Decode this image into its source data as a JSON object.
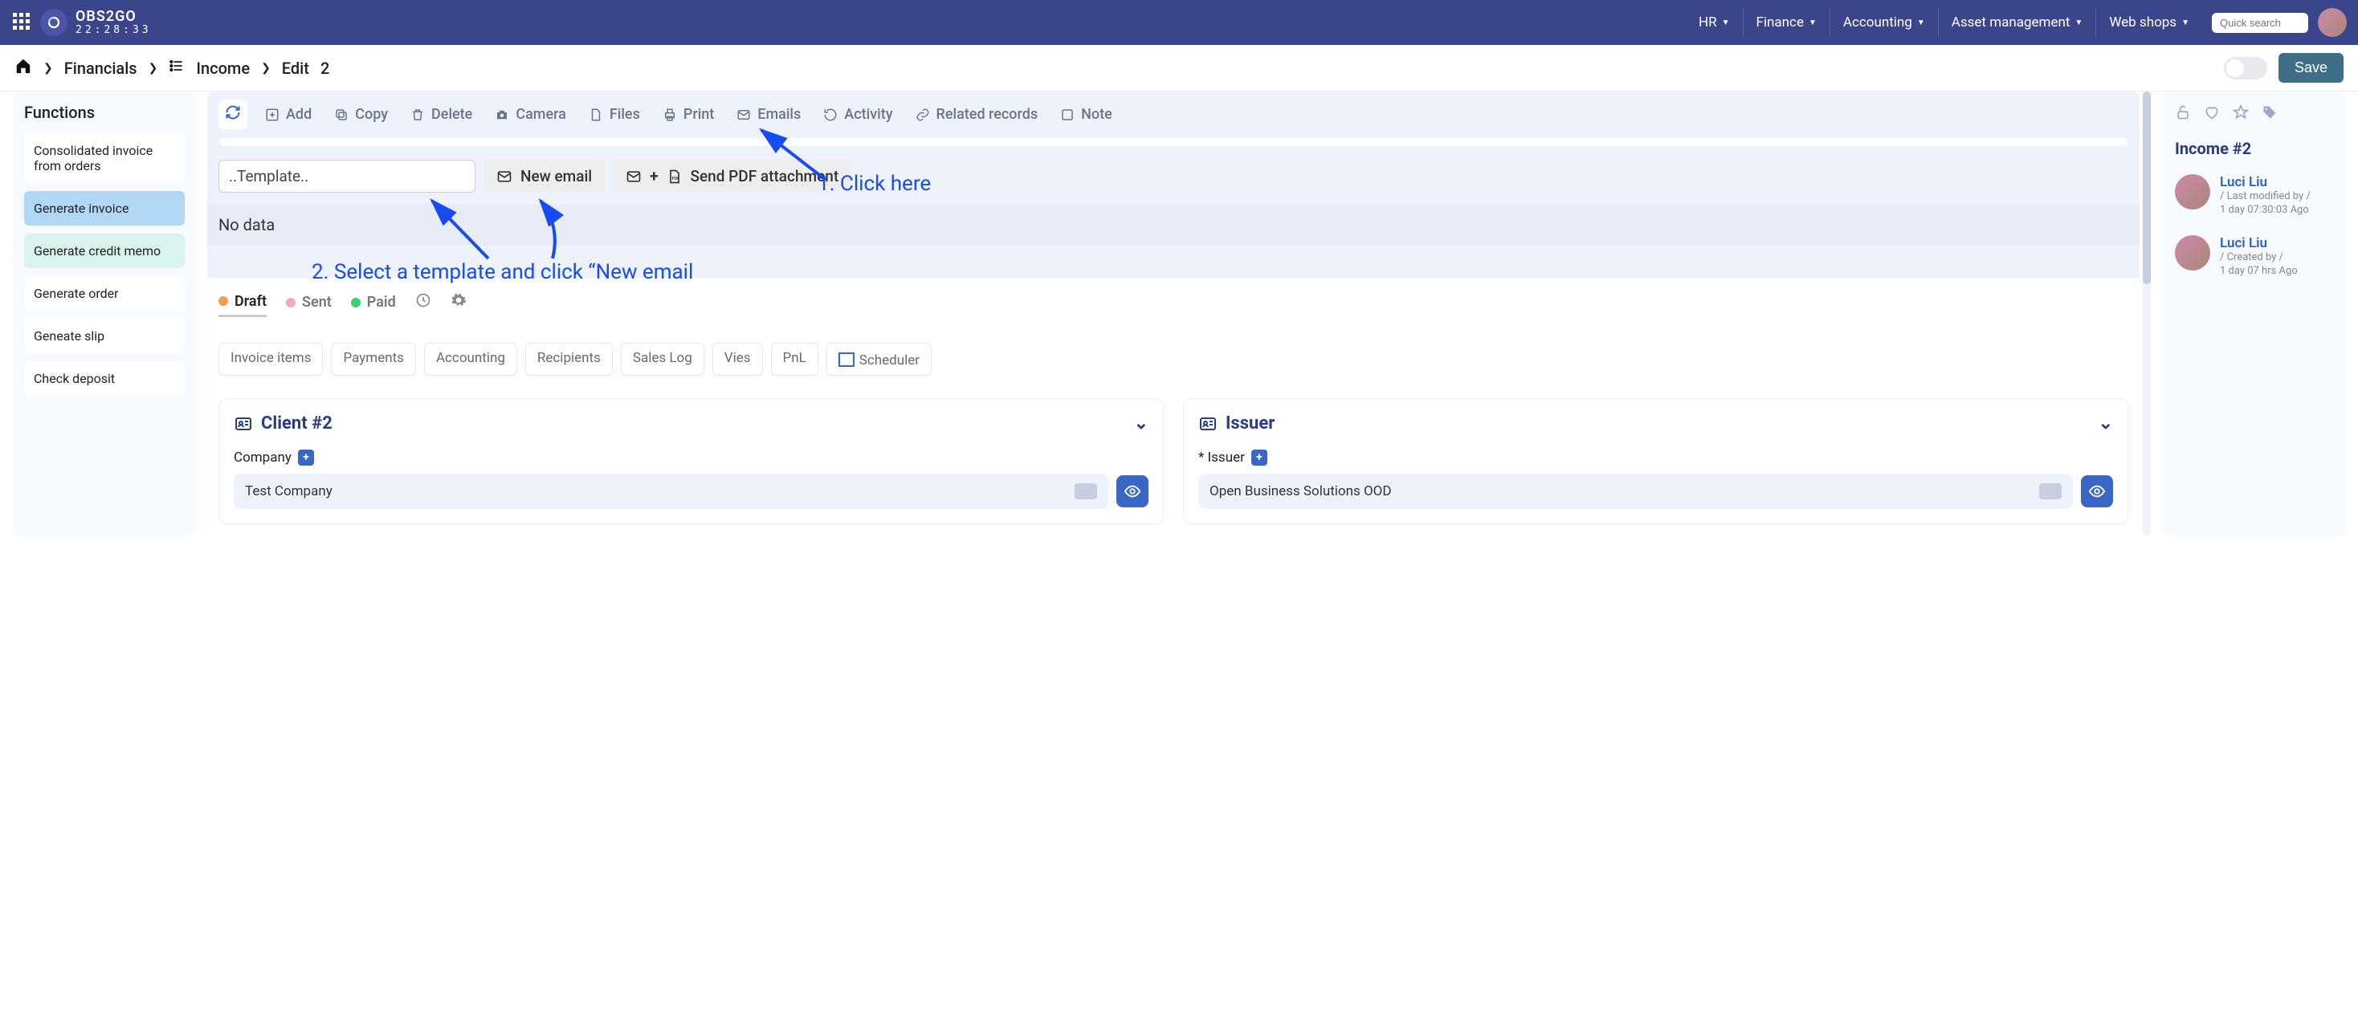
{
  "topbar": {
    "brand_line1": "OBS2GO",
    "brand_line2": "22:28:33",
    "nav": {
      "hr": "HR",
      "finance": "Finance",
      "accounting": "Accounting",
      "assetmgmt": "Asset management",
      "webshops": "Web shops"
    },
    "search_placeholder": "Quick search"
  },
  "breadcrumbs": {
    "financials": "Financials",
    "income": "Income",
    "edit": "Edit",
    "id": "2"
  },
  "save": "Save",
  "sidebar": {
    "title": "Functions",
    "items": {
      "consolidated": "Consolidated invoice from orders",
      "generate_invoice": "Generate invoice",
      "generate_credit": "Generate credit memo",
      "generate_order": "Generate order",
      "generate_slip": "Geneate slip",
      "check_deposit": "Check deposit"
    }
  },
  "toolbar": {
    "add": "Add",
    "copy": "Copy",
    "delete": "Delete",
    "camera": "Camera",
    "files": "Files",
    "print": "Print",
    "emails": "Emails",
    "activity": "Activity",
    "related": "Related records",
    "notes": "Note"
  },
  "email": {
    "template_placeholder": "..Template..",
    "new_email": "New email",
    "send_pdf": "Send PDF attachment",
    "nodata": "No data"
  },
  "status": {
    "draft": "Draft",
    "sent": "Sent",
    "paid": "Paid"
  },
  "tabs": {
    "invoice_items": "Invoice items",
    "payments": "Payments",
    "accounting": "Accounting",
    "recipients": "Recipients",
    "saleslog": "Sales Log",
    "vies": "Vies",
    "pnl": "PnL",
    "scheduler": "Scheduler"
  },
  "cards": {
    "client": {
      "title": "Client #2",
      "company_label": "Company",
      "company_value": "Test Company"
    },
    "issuer": {
      "title": "Issuer",
      "issuer_label": "* Issuer",
      "issuer_value": "Open Business Solutions OOD"
    }
  },
  "right": {
    "title": "Income #2",
    "p1": {
      "name": "Luci Liu",
      "meta1": "/ Last modified by /",
      "meta2": "1 day 07:30:03 Ago"
    },
    "p2": {
      "name": "Luci Liu",
      "meta1": "/ Created by /",
      "meta2": "1 day 07 hrs Ago"
    }
  },
  "annotations": {
    "a1": "1. Click here",
    "a2": "2. Select a template and click “New email"
  }
}
